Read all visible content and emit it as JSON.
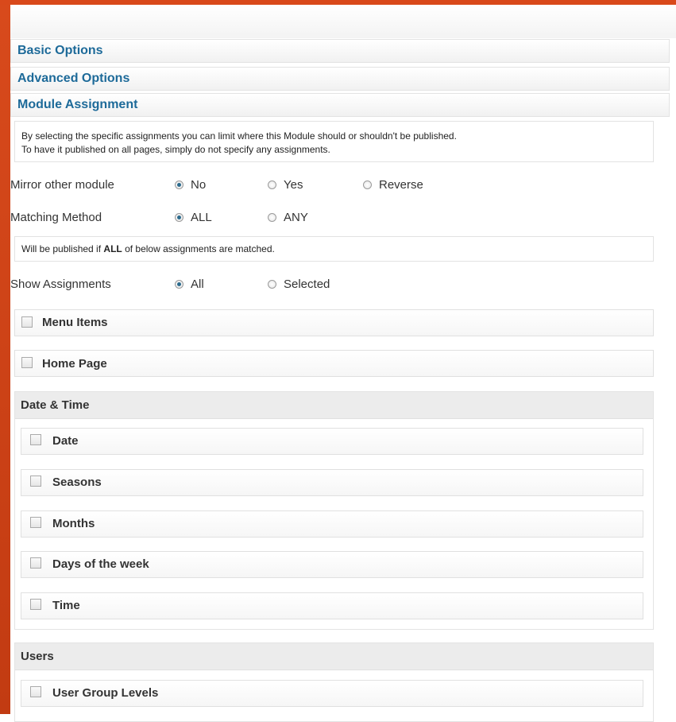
{
  "panels": {
    "basic": "Basic Options",
    "advanced": "Advanced Options",
    "assignment": "Module Assignment"
  },
  "intro": {
    "line1": "By selecting the specific assignments you can limit where this Module should or shouldn't be published.",
    "line2": "To have it published on all pages, simply do not specify any assignments."
  },
  "mirror": {
    "label": "Mirror other module",
    "options": [
      "No",
      "Yes",
      "Reverse"
    ],
    "selected": "No"
  },
  "matching": {
    "label": "Matching Method",
    "options": [
      "ALL",
      "ANY"
    ],
    "selected": "ALL",
    "note_prefix": "Will be published if",
    "note_bold": "ALL",
    "note_suffix": "of below assignments are matched."
  },
  "show": {
    "label": "Show Assignments",
    "options": [
      "All",
      "Selected"
    ],
    "selected": "All"
  },
  "items": {
    "menu_items": "Menu Items",
    "home_page": "Home Page"
  },
  "date_time": {
    "title": "Date & Time",
    "items": [
      "Date",
      "Seasons",
      "Months",
      "Days of the week",
      "Time"
    ]
  },
  "users": {
    "title": "Users",
    "items": [
      "User Group Levels"
    ]
  },
  "colors": {
    "accent": "#d9491b",
    "link": "#1d6a99"
  }
}
